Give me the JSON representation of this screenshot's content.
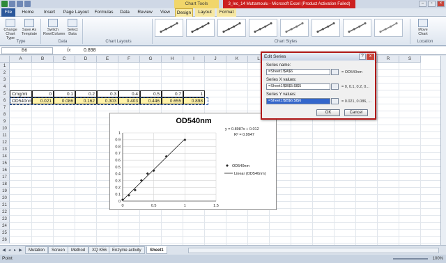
{
  "window": {
    "title": "3_lec_14 Muttamoulu - Microsoft Excel (Product Activation Failed)",
    "context_tab": "Chart Tools"
  },
  "tabs": [
    "File",
    "Home",
    "Insert",
    "Page Layout",
    "Formulas",
    "Data",
    "Review",
    "View",
    "Design",
    "Layout",
    "Format"
  ],
  "active_tab": "Design",
  "ribbon": {
    "type_group": {
      "change_chart_type": "Change\nChart Type",
      "save_as_template": "Save As\nTemplate",
      "label": "Type"
    },
    "data_group": {
      "switch_row_column": "Switch\nRow/Column",
      "select_data": "Select\nData",
      "label": "Data"
    },
    "layouts_label": "Chart Layouts",
    "styles_label": "Chart Styles",
    "location_group": {
      "move_chart": "Move\nChart",
      "label": "Location"
    }
  },
  "formula_bar": {
    "name_box": "B6",
    "fx": "fx",
    "value": "0.898"
  },
  "columns": [
    "A",
    "B",
    "C",
    "D",
    "E",
    "F",
    "G",
    "H",
    "I",
    "J",
    "K",
    "L",
    "M",
    "N",
    "O",
    "P",
    "Q",
    "R",
    "S"
  ],
  "rows": [
    "1",
    "2",
    "3",
    "4",
    "5",
    "6",
    "7",
    "8",
    "9",
    "10",
    "11",
    "12",
    "13",
    "14",
    "15",
    "16",
    "17",
    "18",
    "19",
    "20",
    "21",
    "22",
    "23",
    "24",
    "25",
    "26"
  ],
  "cells": {
    "a5": "Cmg/ml",
    "a6": "OD540nm",
    "row5": [
      "0",
      "0.1",
      "0.2",
      "0.3",
      "0.4",
      "0.5",
      "0.7",
      "1"
    ],
    "row6": [
      "0.021",
      "0.086",
      "0.162",
      "0.303",
      "0.403",
      "0.446",
      "0.655",
      "0.898"
    ]
  },
  "chart": {
    "title": "OD540nm",
    "equation": "y = 0.8987x + 0.012",
    "r2": "R² = 0.9947",
    "legend_series": "OD540nm",
    "legend_trend": "Linear (OD540nm)",
    "y_ticks": [
      "0",
      "0.1",
      "0.2",
      "0.3",
      "0.4",
      "0.5",
      "0.6",
      "0.7",
      "0.8",
      "0.9",
      "1"
    ],
    "x_ticks": [
      "0",
      "0.5",
      "1",
      "1.5"
    ]
  },
  "chart_data": {
    "type": "scatter",
    "title": "OD540nm",
    "xlabel": "",
    "ylabel": "",
    "xlim": [
      0,
      1.5
    ],
    "ylim": [
      0,
      1
    ],
    "series": [
      {
        "name": "OD540nm",
        "x": [
          0,
          0.1,
          0.2,
          0.3,
          0.4,
          0.5,
          0.7,
          1
        ],
        "y": [
          0.021,
          0.086,
          0.162,
          0.303,
          0.403,
          0.446,
          0.655,
          0.898
        ]
      }
    ],
    "trendline": {
      "name": "Linear (OD540nm)",
      "slope": 0.8987,
      "intercept": 0.012,
      "r2": 0.9947
    },
    "grid": true,
    "legend": "right"
  },
  "dialog": {
    "title": "Edit Series",
    "help": "?",
    "close": "x",
    "series_name_label": "Series name:",
    "series_name_value": "=Sheet1!$A$6",
    "series_name_preview": "= OD540nm",
    "x_values_label": "Series X values:",
    "x_values_value": "=Sheet1!$B$5:$I$5",
    "x_values_preview": "= 0, 0.1, 0.2, 0...",
    "y_values_label": "Series Y values:",
    "y_values_value": "=Sheet1!$B$6:$I$6",
    "y_values_preview": "= 0.021, 0.086, ...",
    "ok": "OK",
    "cancel": "Cancel"
  },
  "sheet_tabs": [
    "Mutation",
    "Screen",
    "Method",
    "XQ K56",
    "Enzyme activity",
    "Sheet1"
  ],
  "active_sheet": "Sheet1",
  "status": {
    "mode": "Point",
    "zoom": "100%"
  },
  "colors": {
    "accent": "#2b579a",
    "chart_tools": "#f1d66a",
    "title_bar_red": "#cc1f1f",
    "dialog_border": "#b01818"
  }
}
